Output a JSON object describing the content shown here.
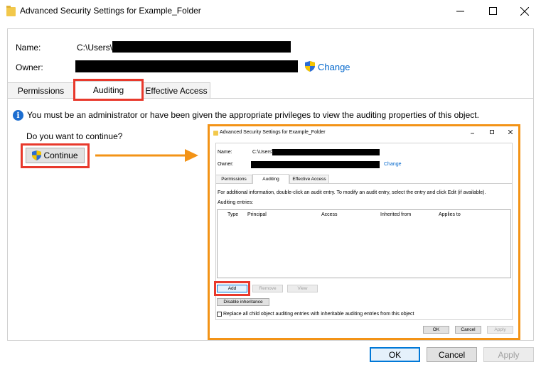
{
  "window": {
    "title": "Advanced Security Settings for Example_Folder"
  },
  "fields": {
    "name_label": "Name:",
    "name_value": "C:\\Users\\",
    "owner_label": "Owner:",
    "change_label": "Change"
  },
  "tabs": [
    {
      "label": "Permissions"
    },
    {
      "label": "Auditing"
    },
    {
      "label": "Effective Access"
    }
  ],
  "info": {
    "icon_glyph": "i",
    "message": "You must be an administrator or have been given the appropriate privileges to view the auditing properties of this object."
  },
  "prompt": {
    "question": "Do you want to continue?",
    "continue_label": "Continue"
  },
  "footer": {
    "ok": "OK",
    "cancel": "Cancel",
    "apply": "Apply"
  },
  "mini_dialog": {
    "title": "Advanced Security Settings for Example_Folder",
    "name_label": "Name:",
    "name_value": "C:\\Users\\",
    "owner_label": "Owner:",
    "change_label": "Change",
    "tabs": [
      "Permissions",
      "Auditing",
      "Effective Access"
    ],
    "info_text": "For additional information, double-click an audit entry. To modify an audit entry, select the entry and click Edit (if available).",
    "entries_label": "Auditing entries:",
    "columns": [
      "Type",
      "Principal",
      "Access",
      "Inherited from",
      "Applies to"
    ],
    "add": "Add",
    "remove": "Remove",
    "view": "View",
    "disable_inheritance": "Disable inheritance",
    "replace_checkbox": "Replace all child object auditing entries with inheritable auditing entries from this object",
    "ok": "OK",
    "cancel": "Cancel",
    "apply": "Apply"
  },
  "colors": {
    "highlight_red": "#e8392c",
    "highlight_orange": "#f39316",
    "link_blue": "#0066cc",
    "accent": "#0078d7"
  }
}
